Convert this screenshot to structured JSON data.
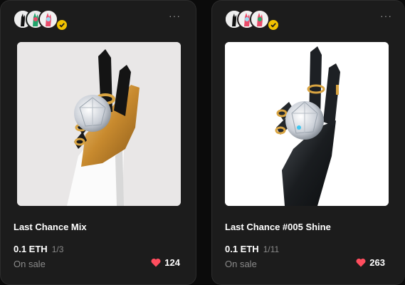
{
  "cards": [
    {
      "title": "Last Chance Mix",
      "price": "0.1 ETH",
      "edition": "1/3",
      "status": "On sale",
      "likes": "124"
    },
    {
      "title": "Last Chance #005 Shine",
      "price": "0.1 ETH",
      "edition": "1/11",
      "status": "On sale",
      "likes": "263"
    }
  ],
  "more_label": "···",
  "colors": {
    "card_bg": "#1c1c1c",
    "muted_text": "#8a8a8a",
    "heart": "#ff4d5e",
    "verified": "#f2c200",
    "gold": "#d9a441"
  }
}
